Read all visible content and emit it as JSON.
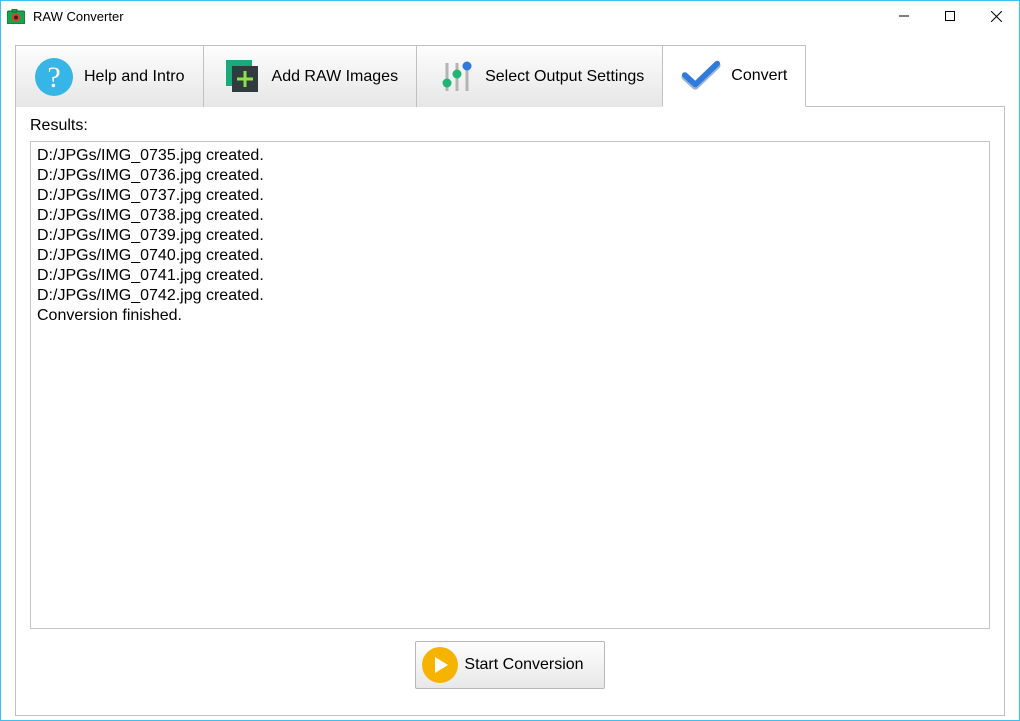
{
  "window": {
    "title": "RAW Converter"
  },
  "tabs": {
    "help": "Help and Intro",
    "add": "Add RAW Images",
    "settings": "Select Output Settings",
    "convert": "Convert"
  },
  "results": {
    "label": "Results:",
    "lines": [
      "D:/JPGs/IMG_0735.jpg created.",
      "D:/JPGs/IMG_0736.jpg created.",
      "D:/JPGs/IMG_0737.jpg created.",
      "D:/JPGs/IMG_0738.jpg created.",
      "D:/JPGs/IMG_0739.jpg created.",
      "D:/JPGs/IMG_0740.jpg created.",
      "D:/JPGs/IMG_0741.jpg created.",
      "D:/JPGs/IMG_0742.jpg created.",
      "Conversion finished."
    ]
  },
  "buttons": {
    "start": "Start Conversion"
  }
}
